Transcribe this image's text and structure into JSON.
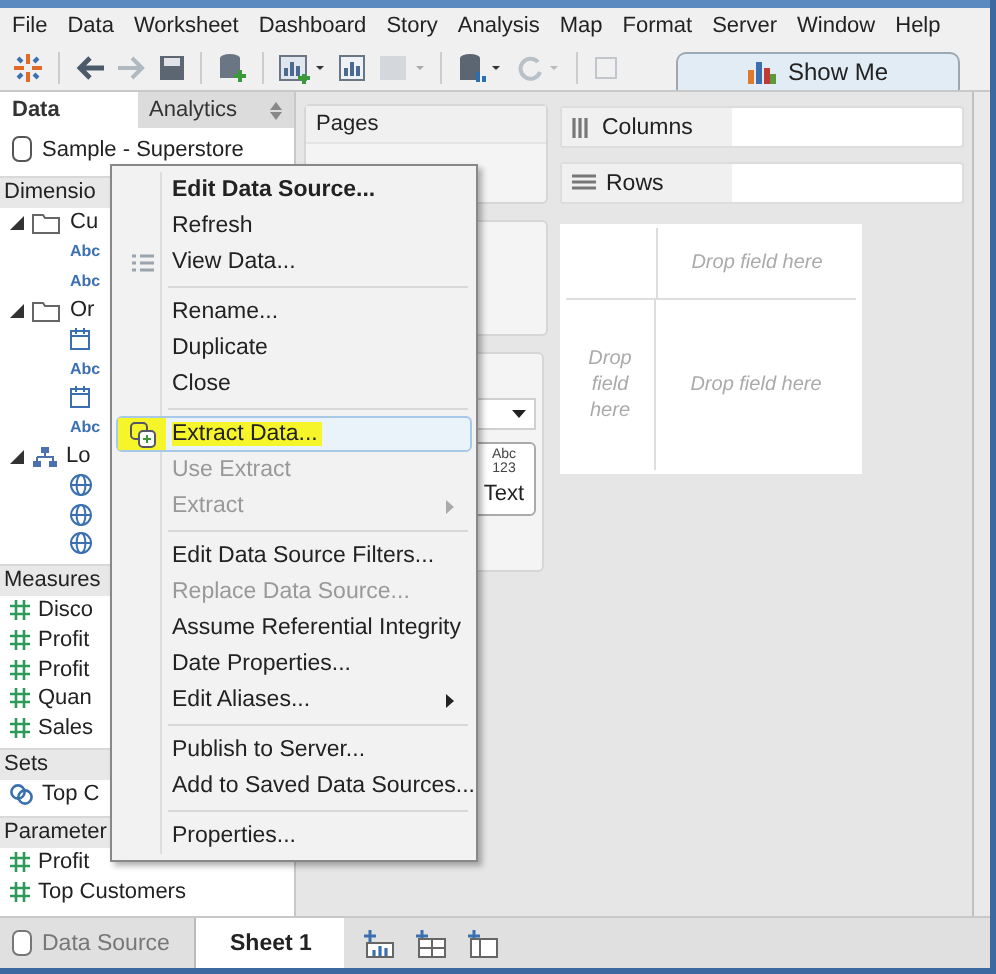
{
  "menubar": [
    "File",
    "Data",
    "Worksheet",
    "Dashboard",
    "Story",
    "Analysis",
    "Map",
    "Format",
    "Server",
    "Window",
    "Help"
  ],
  "show_me": {
    "label": "Show Me"
  },
  "side_tabs": [
    {
      "label": "Data",
      "selected": true
    },
    {
      "label": "Analytics",
      "selected": false
    }
  ],
  "data_source": "Sample - Superstore",
  "sections": [
    {
      "title": "Dimensio",
      "items": [
        {
          "kind": "folder",
          "label": "Cu",
          "expanded": true,
          "children": [
            {
              "kind": "abc",
              "badge": "Abc"
            },
            {
              "kind": "abc",
              "badge": "Abc"
            }
          ]
        },
        {
          "kind": "folder",
          "label": "Or",
          "expanded": true,
          "children": [
            {
              "kind": "date"
            },
            {
              "kind": "abc",
              "badge": "Abc"
            },
            {
              "kind": "date"
            },
            {
              "kind": "abc",
              "badge": "Abc"
            }
          ]
        },
        {
          "kind": "hierarchy",
          "label": "Lo",
          "expanded": true,
          "children": [
            {
              "kind": "globe"
            },
            {
              "kind": "globe"
            },
            {
              "kind": "globe"
            }
          ]
        }
      ]
    },
    {
      "title": "Measures",
      "items": [
        {
          "kind": "measure",
          "label": "Disco"
        },
        {
          "kind": "measure",
          "label": "Profit"
        },
        {
          "kind": "measure",
          "label": "Profit"
        },
        {
          "kind": "measure",
          "label": "Quan"
        },
        {
          "kind": "measure",
          "label": "Sales"
        }
      ]
    },
    {
      "title": "Sets",
      "items": [
        {
          "kind": "set",
          "label": "Top C"
        }
      ]
    },
    {
      "title": "Parameter",
      "items": [
        {
          "kind": "measure",
          "label": "Profit"
        },
        {
          "kind": "measure",
          "label": "Top Customers"
        }
      ]
    }
  ],
  "pages_card": {
    "title": "Pages"
  },
  "marks": {
    "text_button": {
      "label": "Text",
      "glyph": [
        "Abc",
        "123"
      ]
    }
  },
  "shelves": [
    {
      "kind": "columns",
      "label": "Columns"
    },
    {
      "kind": "rows",
      "label": "Rows"
    }
  ],
  "view": {
    "top_right": "Drop field here",
    "left": "Drop field here",
    "center": "Drop field here"
  },
  "context_menu": {
    "groups": [
      [
        {
          "label": "Edit Data Source...",
          "kind": "plain",
          "bold": true,
          "disabled": false,
          "submenu": false,
          "selected": false
        },
        {
          "label": "Refresh",
          "kind": "plain",
          "bold": false,
          "disabled": false,
          "submenu": false,
          "selected": false
        },
        {
          "label": "View Data...",
          "kind": "table",
          "bold": false,
          "disabled": false,
          "submenu": false,
          "selected": false
        }
      ],
      [
        {
          "label": "Rename...",
          "kind": "plain",
          "bold": false,
          "disabled": false,
          "submenu": false,
          "selected": false
        },
        {
          "label": "Duplicate",
          "kind": "plain",
          "bold": false,
          "disabled": false,
          "submenu": false,
          "selected": false
        },
        {
          "label": "Close",
          "kind": "plain",
          "bold": false,
          "disabled": false,
          "submenu": false,
          "selected": false
        }
      ],
      [
        {
          "label": "Extract Data...",
          "kind": "extract",
          "bold": false,
          "disabled": false,
          "submenu": false,
          "selected": true
        },
        {
          "label": "Use Extract",
          "kind": "plain",
          "bold": false,
          "disabled": true,
          "submenu": false,
          "selected": false
        },
        {
          "label": "Extract",
          "kind": "plain",
          "bold": false,
          "disabled": true,
          "submenu": true,
          "selected": false
        }
      ],
      [
        {
          "label": "Edit Data Source Filters...",
          "kind": "plain",
          "bold": false,
          "disabled": false,
          "submenu": false,
          "selected": false
        },
        {
          "label": "Replace Data Source...",
          "kind": "plain",
          "bold": false,
          "disabled": true,
          "submenu": false,
          "selected": false
        },
        {
          "label": "Assume Referential Integrity",
          "kind": "plain",
          "bold": false,
          "disabled": false,
          "submenu": false,
          "selected": false
        },
        {
          "label": "Date Properties...",
          "kind": "plain",
          "bold": false,
          "disabled": false,
          "submenu": false,
          "selected": false
        },
        {
          "label": "Edit Aliases...",
          "kind": "plain",
          "bold": false,
          "disabled": false,
          "submenu": true,
          "selected": false
        }
      ],
      [
        {
          "label": "Publish to Server...",
          "kind": "plain",
          "bold": false,
          "disabled": false,
          "submenu": false,
          "selected": false
        },
        {
          "label": "Add to Saved Data Sources...",
          "kind": "plain",
          "bold": false,
          "disabled": false,
          "submenu": false,
          "selected": false
        }
      ],
      [
        {
          "label": "Properties...",
          "kind": "plain",
          "bold": false,
          "disabled": false,
          "submenu": false,
          "selected": false
        }
      ]
    ]
  },
  "bottom_tabs": [
    {
      "kind": "data-source",
      "label": "Data Source",
      "selected": false
    },
    {
      "kind": "sheet",
      "label": "Sheet 1",
      "selected": true
    }
  ]
}
